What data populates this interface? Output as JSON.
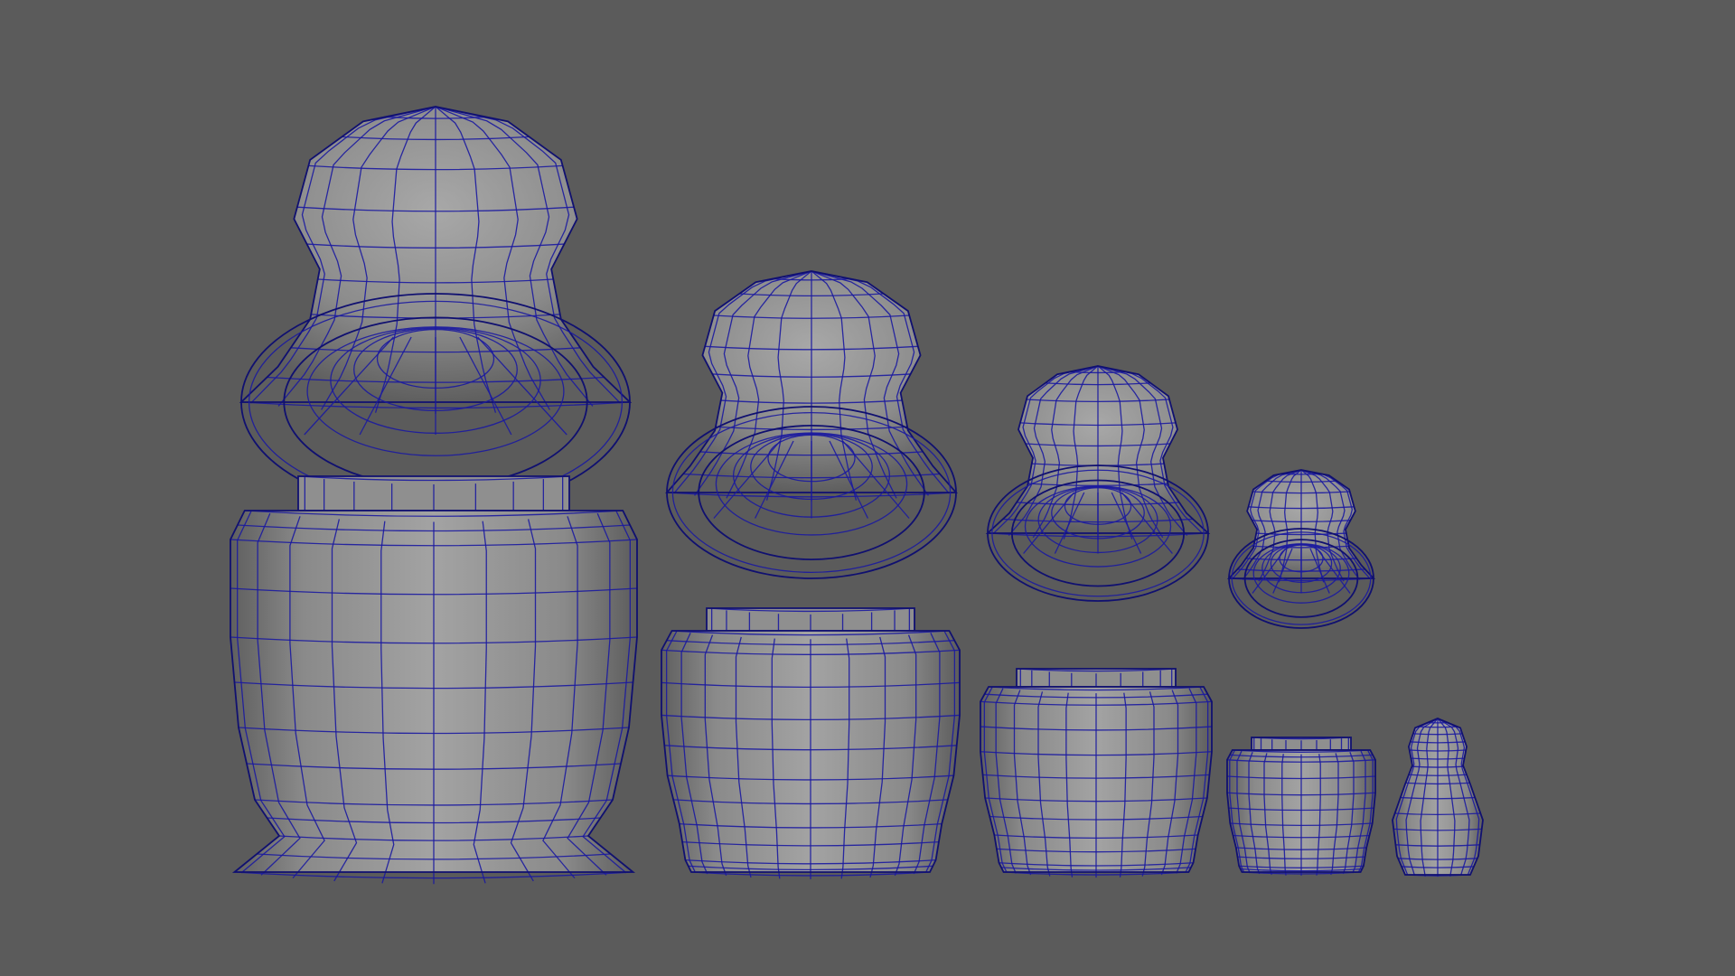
{
  "viewport": {
    "background": "#5b5b5b",
    "wire_color": "#1b1aa0",
    "mesh_color": "#9a9a9a"
  },
  "scene": {
    "objects": [
      {
        "name": "doll-1-head",
        "kind": "head-shell"
      },
      {
        "name": "doll-1-body",
        "kind": "body-base"
      },
      {
        "name": "doll-2-head",
        "kind": "head-shell"
      },
      {
        "name": "doll-2-body",
        "kind": "body-base"
      },
      {
        "name": "doll-3-head",
        "kind": "head-shell"
      },
      {
        "name": "doll-3-body",
        "kind": "body-base"
      },
      {
        "name": "doll-4-head",
        "kind": "head-shell"
      },
      {
        "name": "doll-4-body",
        "kind": "body-base"
      },
      {
        "name": "doll-5",
        "kind": "solid-doll"
      }
    ]
  }
}
